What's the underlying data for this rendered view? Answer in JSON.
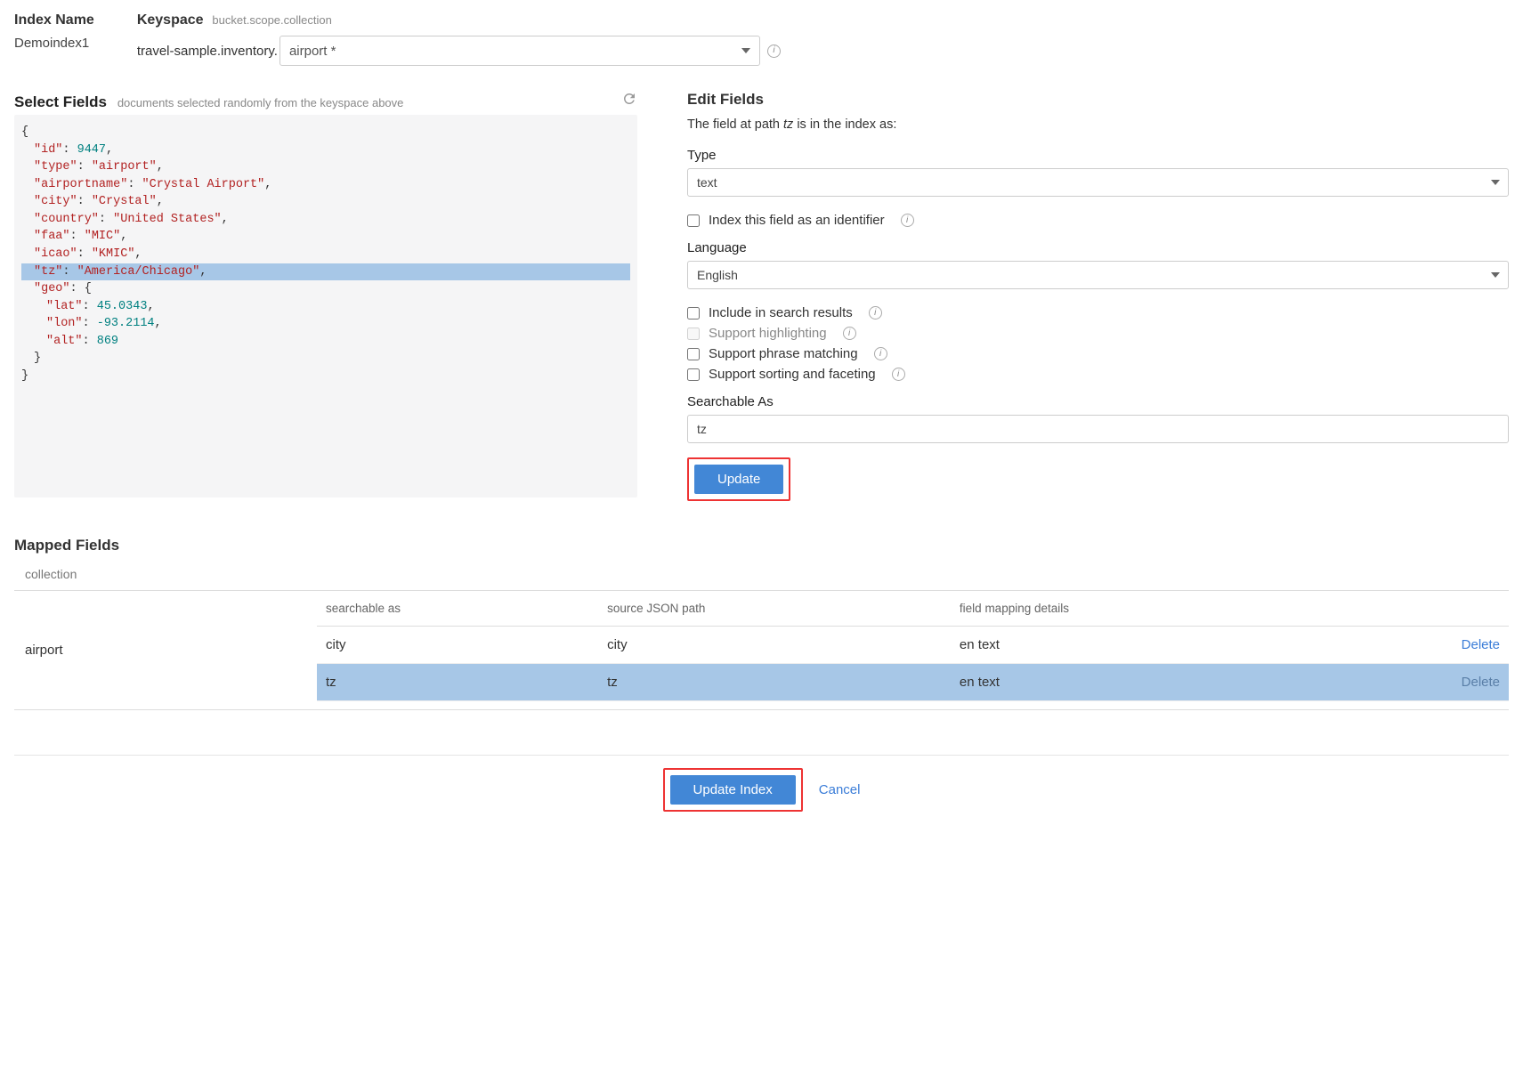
{
  "header": {
    "index_name_label": "Index Name",
    "index_name_value": "Demoindex1",
    "keyspace_label": "Keyspace",
    "keyspace_hint": "bucket.scope.collection",
    "keyspace_prefix": "travel-sample.inventory.",
    "keyspace_selected": "airport *"
  },
  "select_fields": {
    "title": "Select Fields",
    "subtitle": "documents selected randomly from the keyspace above",
    "doc": {
      "id_key": "\"id\"",
      "id_val": "9447",
      "type_key": "\"type\"",
      "type_val": "\"airport\"",
      "airportname_key": "\"airportname\"",
      "airportname_val": "\"Crystal Airport\"",
      "city_key": "\"city\"",
      "city_val": "\"Crystal\"",
      "country_key": "\"country\"",
      "country_val": "\"United States\"",
      "faa_key": "\"faa\"",
      "faa_val": "\"MIC\"",
      "icao_key": "\"icao\"",
      "icao_val": "\"KMIC\"",
      "tz_key": "\"tz\"",
      "tz_val": "\"America/Chicago\"",
      "geo_key": "\"geo\"",
      "lat_key": "\"lat\"",
      "lat_val": "45.0343",
      "lon_key": "\"lon\"",
      "lon_val": "-93.2114",
      "alt_key": "\"alt\"",
      "alt_val": "869"
    }
  },
  "edit": {
    "title": "Edit Fields",
    "desc_pre": "The field at path ",
    "desc_field": "tz",
    "desc_post": " is in the index as:",
    "type_label": "Type",
    "type_value": "text",
    "identifier_label": "Index this field as an identifier",
    "language_label": "Language",
    "language_value": "English",
    "cb_include": "Include in search results",
    "cb_highlight": "Support highlighting",
    "cb_phrase": "Support phrase matching",
    "cb_sort": "Support sorting and faceting",
    "searchable_label": "Searchable As",
    "searchable_value": "tz",
    "update_btn": "Update"
  },
  "mapped": {
    "title": "Mapped Fields",
    "collection_label": "collection",
    "collection_value": "airport",
    "cols": {
      "c1": "searchable as",
      "c2": "source JSON path",
      "c3": "field mapping details"
    },
    "rows": [
      {
        "searchable": "city",
        "path": "city",
        "details": "en text",
        "delete": "Delete",
        "selected": false
      },
      {
        "searchable": "tz",
        "path": "tz",
        "details": "en text",
        "delete": "Delete",
        "selected": true
      }
    ]
  },
  "footer": {
    "update_index": "Update Index",
    "cancel": "Cancel"
  }
}
